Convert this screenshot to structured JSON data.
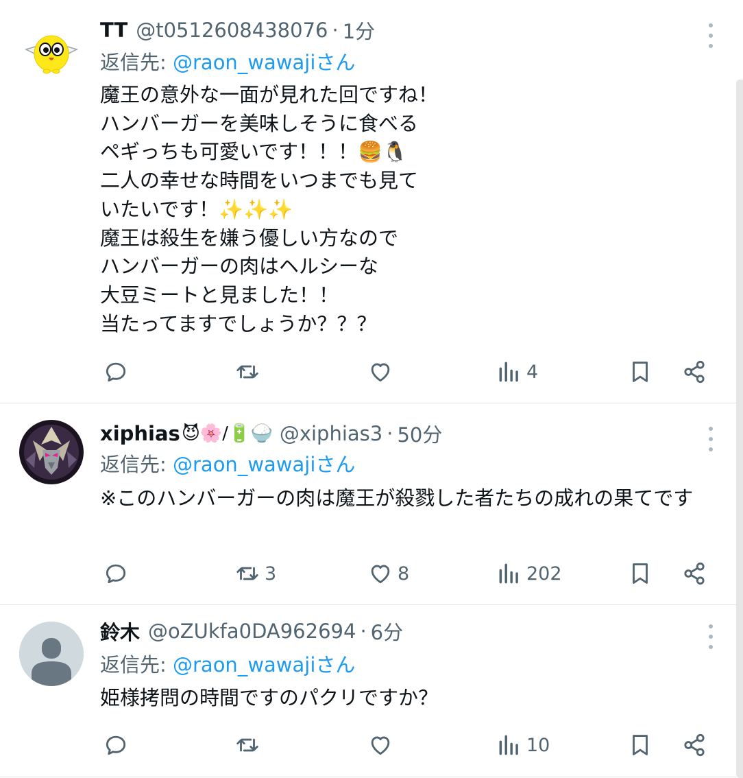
{
  "replies": [
    {
      "display_name": "TT",
      "name_suffix": "",
      "handle": "@t0512608438076",
      "separator": "·",
      "time": "1分",
      "reply_prefix": "返信先: ",
      "reply_mention": "@raon_wawajiさん",
      "body": "魔王の意外な一面が見れた回ですね！\nハンバーガーを美味しそうに食べる\nペギっちも可愛いです！！！🍔🐧\n二人の幸せな時間をいつまでも見て\nいたいです！✨✨✨\n魔王は殺生を嫌う優しい方なので\nハンバーガーの肉はヘルシーな\n大豆ミートと見ました！！\n当たってますでしょうか？？？",
      "counts": {
        "reply": "",
        "retweet": "",
        "like": "",
        "views": "4"
      },
      "avatar_icon": "yellow-bird-avatar"
    },
    {
      "display_name": "xiphias",
      "name_suffix": "😈🌸/🔋🍚",
      "handle": "@xiphias3",
      "separator": "·",
      "time": "50分",
      "reply_prefix": "返信先: ",
      "reply_mention": "@raon_wawajiさん",
      "body": "※このハンバーガーの肉は魔王が殺戮した者たちの成れの果てです",
      "counts": {
        "reply": "",
        "retweet": "3",
        "like": "8",
        "views": "202"
      },
      "avatar_icon": "robot-avatar"
    },
    {
      "display_name": "鈴木",
      "name_suffix": "",
      "handle": "@oZUkfa0DA962694",
      "separator": "·",
      "time": "6分",
      "reply_prefix": "返信先: ",
      "reply_mention": "@raon_wawajiさん",
      "body": "姫様拷問の時間ですのパクリですか？",
      "counts": {
        "reply": "",
        "retweet": "",
        "like": "",
        "views": "10"
      },
      "avatar_icon": "default-user-avatar"
    }
  ],
  "colors": {
    "text": "#0f1419",
    "secondary": "#536471",
    "mention": "#1d9bf0",
    "divider": "#e1e5e8",
    "default_avatar_bg": "#cfd9de"
  }
}
